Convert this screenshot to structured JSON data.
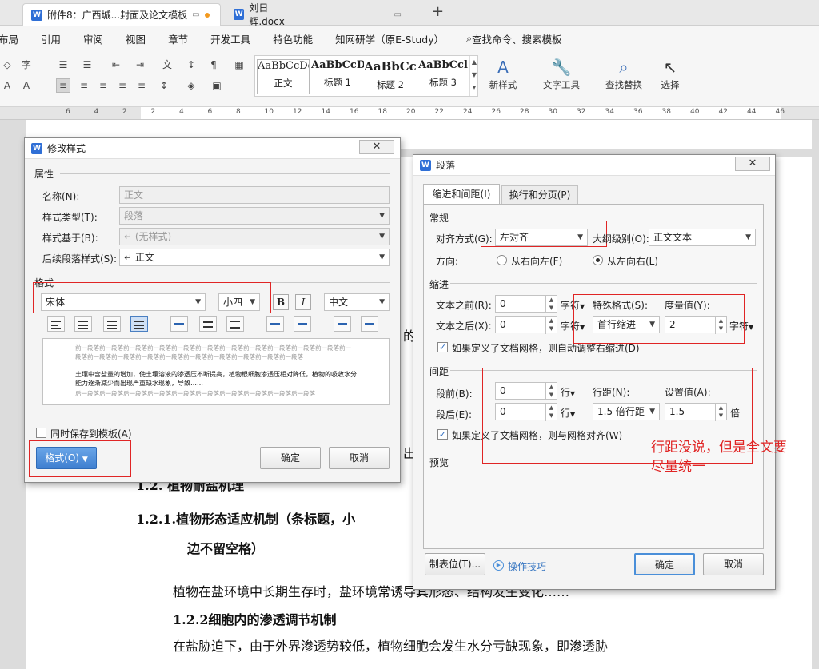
{
  "tabs": [
    {
      "title": "附件8：广西城...封面及论文模板",
      "modified": true
    },
    {
      "title": "刘日辉.docx",
      "modified": false
    }
  ],
  "new_tab_glyph": "+",
  "menu": [
    "布局",
    "引用",
    "审阅",
    "视图",
    "章节",
    "开发工具",
    "特色功能",
    "知网研学（原E-Study）",
    "查找命令、搜索模板"
  ],
  "ribbon": {
    "styles": [
      {
        "preview": "AaBbCcDd",
        "name": "正文"
      },
      {
        "preview": "AaBbCcD",
        "name": "标题 1"
      },
      {
        "preview": "AaBbCc",
        "name": "标题 2"
      },
      {
        "preview": "AaBbCcl",
        "name": "标题 3"
      }
    ],
    "new_style": "新样式",
    "text_tools": "文字工具",
    "find_replace": "查找替换",
    "select": "选择"
  },
  "ruler_ticks": [
    "6",
    "4",
    "2",
    "2",
    "4",
    "6",
    "8",
    "10",
    "12",
    "14",
    "16",
    "18",
    "20",
    "22",
    "24",
    "26",
    "28",
    "30",
    "32",
    "34",
    "36",
    "38",
    "40",
    "42",
    "44",
    "46"
  ],
  "document": {
    "heading_1_2_1_a": "1.2.1.植物形态适应机制（条标题，小",
    "heading_1_2_1_b": "边不留空格）",
    "para1": "植物在盐环境中长期生存时，盐环境常诱导其形态、结构发生变化……",
    "heading_1_2_2": "1.2.2细胞内的渗透调节机制",
    "para2": "在盐胁迫下，由于外界渗透势较低，植物细胞会发生水分亏缺现象，即渗透胁",
    "hidden_fragment_1": "的",
    "hidden_fragment_2": "出",
    "hidden_heading": "1.2. 植物耐盐机理"
  },
  "style_dialog": {
    "title": "修改样式",
    "attributes_section": "属性",
    "name_label": "名称(N):",
    "name_value": "正文",
    "type_label": "样式类型(T):",
    "type_value": "段落",
    "based_on_label": "样式基于(B):",
    "based_on_value": "↵ (无样式)",
    "next_label": "后续段落样式(S):",
    "next_value": "↵ 正文",
    "format_section": "格式",
    "font_value": "宋体",
    "size_value": "小四",
    "bold_glyph": "B",
    "italic_glyph": "I",
    "lang_value": "中文",
    "preview_before": "前一段落前一段落前一段落前一段落前一段落前一段落前一段落前一段落前一段落前一段落前一段落前一段落前一段落前一段落前一段落前一段落前一段落前一段落前一段落前一段落前一段落",
    "preview_sample": "土壤中含盐量的增加，使土壤溶液的渗透压不断提高，植物根细胞渗透压相对降低，植物的吸收水分能力逐渐减少而出现严重缺水现象，导致……",
    "preview_after": "后一段落后一段落后一段落后一段落后一段落后一段落后一段落后一段落后一段落后一段落",
    "save_to_template": "同时保存到模板(A)",
    "format_button": "格式(O)",
    "ok": "确定",
    "cancel": "取消"
  },
  "para_dialog": {
    "title": "段落",
    "tab_indent": "缩进和间距(I)",
    "tab_breaks": "换行和分页(P)",
    "general": "常规",
    "align_label": "对齐方式(G):",
    "align_value": "左对齐",
    "outline_label": "大纲级别(O):",
    "outline_value": "正文文本",
    "direction_label": "方向:",
    "rtl": "从右向左(F)",
    "ltr": "从左向右(L)",
    "indent": "缩进",
    "before_text_label": "文本之前(R):",
    "before_text_value": "0",
    "after_text_label": "文本之后(X):",
    "after_text_value": "0",
    "unit_char": "字符",
    "special_label": "特殊格式(S):",
    "special_value": "首行缩进",
    "measure_label": "度量值(Y):",
    "measure_value": "2",
    "grid_indent": "如果定义了文档网格，则自动调整右缩进(D)",
    "spacing": "间距",
    "before_label": "段前(B):",
    "before_value": "0",
    "after_label": "段后(E):",
    "after_value": "0",
    "unit_line": "行",
    "line_spacing_label": "行距(N):",
    "line_spacing_value": "1.5 倍行距",
    "setting_label": "设置值(A):",
    "setting_value": "1.5",
    "unit_times": "倍",
    "grid_align": "如果定义了文档网格，则与网格对齐(W)",
    "preview": "预览",
    "tabs_button": "制表位(T)...",
    "tips": "操作技巧",
    "ok": "确定",
    "cancel": "取消"
  },
  "annotation": {
    "line1": "行距没说，但是全文要",
    "line2": "尽量统一",
    "color": "#e02525"
  }
}
